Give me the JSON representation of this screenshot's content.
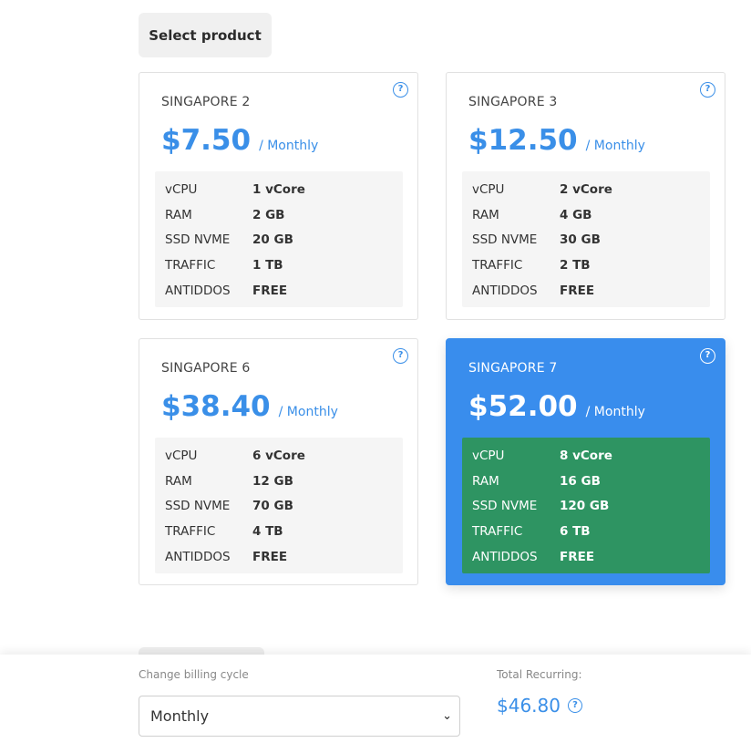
{
  "header": {
    "select_product_label": "Select product"
  },
  "products": [
    {
      "name": "SINGAPORE 2",
      "price": "$7.50",
      "cycle": "/ Monthly",
      "specs": [
        {
          "k": "vCPU",
          "v": "1 vCore"
        },
        {
          "k": "RAM",
          "v": "2 GB"
        },
        {
          "k": "SSD NVME",
          "v": "20 GB"
        },
        {
          "k": "TRAFFIC",
          "v": "1 TB"
        },
        {
          "k": "ANTIDDOS",
          "v": "FREE"
        }
      ],
      "selected": false
    },
    {
      "name": "SINGAPORE 3",
      "price": "$12.50",
      "cycle": "/ Monthly",
      "specs": [
        {
          "k": "vCPU",
          "v": "2 vCore"
        },
        {
          "k": "RAM",
          "v": "4 GB"
        },
        {
          "k": "SSD NVME",
          "v": "30 GB"
        },
        {
          "k": "TRAFFIC",
          "v": "2 TB"
        },
        {
          "k": "ANTIDDOS",
          "v": "FREE"
        }
      ],
      "selected": false
    },
    {
      "name": "SINGAPORE 6",
      "price": "$38.40",
      "cycle": "/ Monthly",
      "specs": [
        {
          "k": "vCPU",
          "v": "6 vCore"
        },
        {
          "k": "RAM",
          "v": "12 GB"
        },
        {
          "k": "SSD NVME",
          "v": "70 GB"
        },
        {
          "k": "TRAFFIC",
          "v": "4 TB"
        },
        {
          "k": "ANTIDDOS",
          "v": "FREE"
        }
      ],
      "selected": false
    },
    {
      "name": "SINGAPORE 7",
      "price": "$52.00",
      "cycle": "/ Monthly",
      "specs": [
        {
          "k": "vCPU",
          "v": "8 vCore"
        },
        {
          "k": "RAM",
          "v": "16 GB"
        },
        {
          "k": "SSD NVME",
          "v": "120 GB"
        },
        {
          "k": "TRAFFIC",
          "v": "6 TB"
        },
        {
          "k": "ANTIDDOS",
          "v": "FREE"
        }
      ],
      "selected": true
    }
  ],
  "footer": {
    "billing_label": "Change billing cycle",
    "billing_value": "Monthly",
    "total_label": "Total Recurring:",
    "total_value": "$46.80"
  },
  "icons": {
    "help": "question-circle-icon",
    "dropdown": "chevron-down-icon"
  },
  "colors": {
    "accent": "#3a8fe8",
    "selected_card": "#398ded",
    "selected_specs": "#2e9462"
  }
}
